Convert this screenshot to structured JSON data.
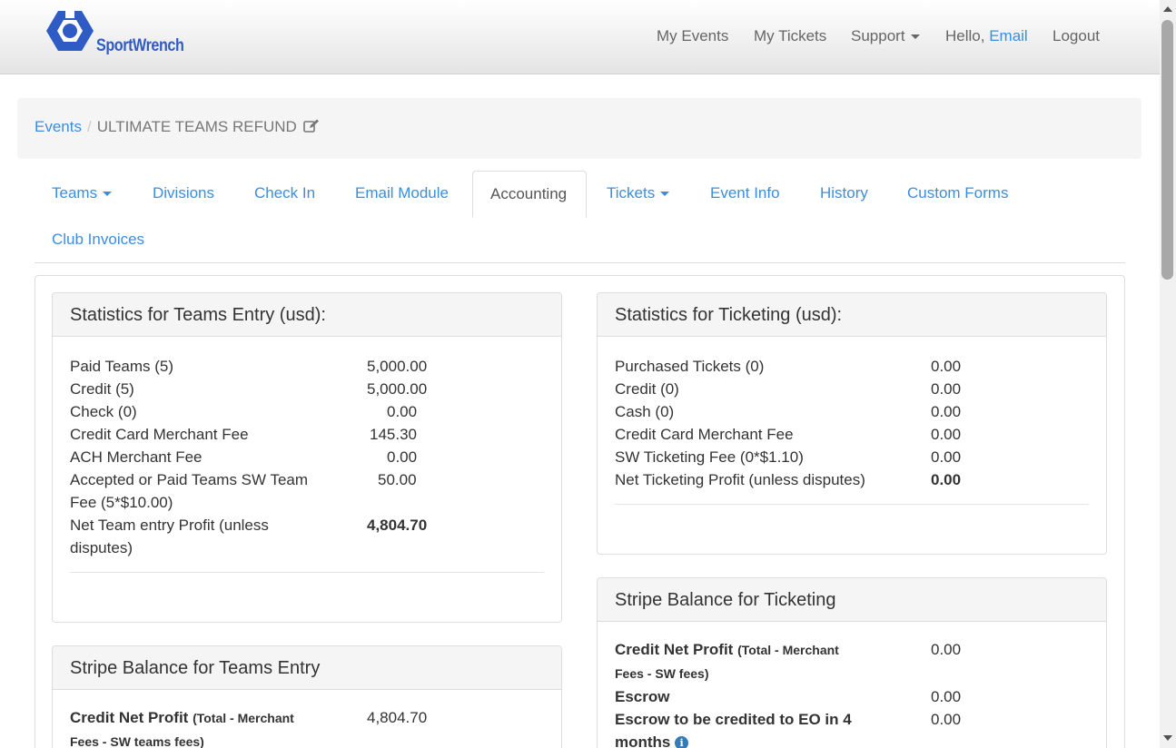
{
  "brand": {
    "name": "SportWrench",
    "logo_color": "#2f5cc4"
  },
  "nav": {
    "my_events": "My Events",
    "my_tickets": "My Tickets",
    "support": "Support",
    "hello": "Hello,",
    "user": "Email",
    "logout": "Logout"
  },
  "breadcrumb": {
    "root": "Events",
    "separator": "/",
    "current": "ULTIMATE TEAMS REFUND"
  },
  "tabs": [
    {
      "label": "Teams",
      "dropdown": true
    },
    {
      "label": "Divisions"
    },
    {
      "label": "Check In"
    },
    {
      "label": "Email Module"
    },
    {
      "label": "Accounting",
      "active": true
    },
    {
      "label": "Tickets",
      "dropdown": true
    },
    {
      "label": "Event Info"
    },
    {
      "label": "History"
    },
    {
      "label": "Custom Forms"
    },
    {
      "label": "Club Invoices"
    }
  ],
  "teams_stats": {
    "title": "Statistics for Teams Entry (usd):",
    "rows": [
      {
        "label": "Paid Teams (5)",
        "value": "5,000.00"
      },
      {
        "label": "Credit (5)",
        "value": "5,000.00"
      },
      {
        "label": "Check (0)",
        "value": "0.00"
      },
      {
        "label": "Credit Card Merchant Fee",
        "value": "145.30"
      },
      {
        "label": "ACH Merchant Fee",
        "value": "0.00"
      },
      {
        "label": "Accepted or Paid Teams SW Team Fee (5*$10.00)",
        "value": "50.00"
      },
      {
        "label": "Net Team entry Profit (unless disputes)",
        "value": "4,804.70"
      }
    ]
  },
  "ticket_stats": {
    "title": "Statistics for Ticketing (usd):",
    "rows": [
      {
        "label": "Purchased Tickets (0)",
        "value": "0.00"
      },
      {
        "label": "Credit (0)",
        "value": "0.00"
      },
      {
        "label": "Cash (0)",
        "value": "0.00"
      },
      {
        "label": "Credit Card Merchant Fee",
        "value": "0.00"
      },
      {
        "label": "SW Ticketing Fee (0*$1.10)",
        "value": "0.00"
      },
      {
        "label": "Net Ticketing Profit (unless disputes)",
        "value": "0.00"
      }
    ]
  },
  "stripe_ticketing": {
    "title": "Stripe Balance for Ticketing",
    "credit_net_label": "Credit Net Profit",
    "credit_net_note": "(Total - Merchant Fees - SW fees)",
    "credit_net_value": "0.00",
    "escrow_label": "Escrow",
    "escrow_value": "0.00",
    "escrow_credit_label": "Escrow to be credited to EO in 4 months",
    "escrow_credit_value": "0.00"
  },
  "stripe_teams": {
    "title": "Stripe Balance for Teams Entry",
    "credit_net_label": "Credit Net Profit",
    "credit_net_note": "(Total - Merchant Fees - SW teams fees)",
    "credit_net_value": "4,804.70"
  },
  "colors": {
    "link": "#3c8dde",
    "panel_heading_bg": "#f5f5f5"
  }
}
